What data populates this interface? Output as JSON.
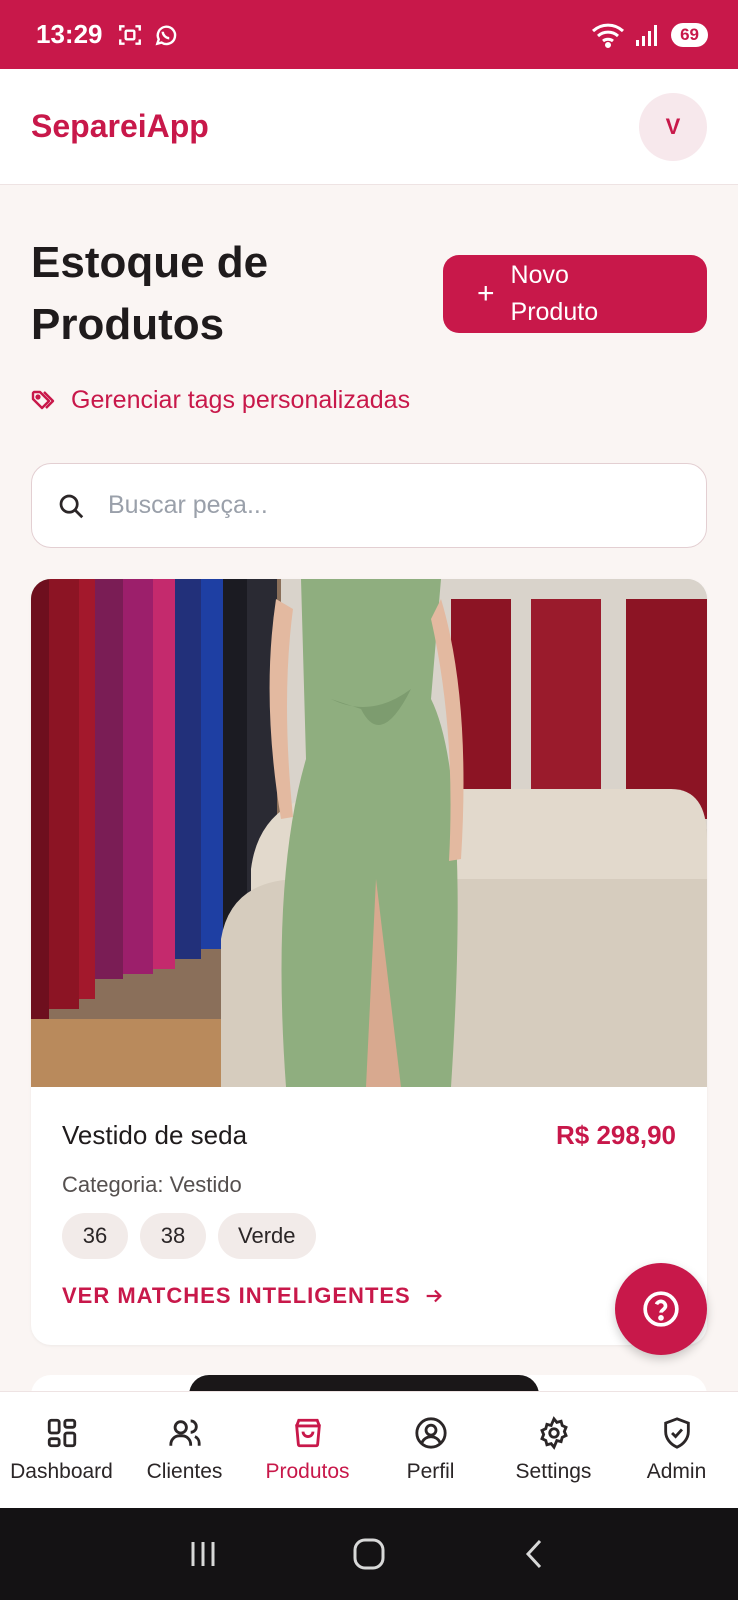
{
  "status_bar": {
    "time": "13:29",
    "battery": "69"
  },
  "header": {
    "app_title": "SepareiApp",
    "avatar_initial": "V"
  },
  "page": {
    "title": "Estoque de Produtos",
    "new_product_button": "Novo Produto",
    "tags_link": "Gerenciar tags personalizadas",
    "search_placeholder": "Buscar peça..."
  },
  "products": [
    {
      "name": "Vestido de seda",
      "price": "R$ 298,90",
      "category": "Categoria: Vestido",
      "chips": [
        "36",
        "38",
        "Verde"
      ],
      "matches_link": "VER MATCHES INTELIGENTES"
    }
  ],
  "bottom_nav": [
    {
      "label": "Dashboard",
      "icon": "grid-icon"
    },
    {
      "label": "Clientes",
      "icon": "users-icon"
    },
    {
      "label": "Produtos",
      "icon": "shopping-bag-icon",
      "active": true
    },
    {
      "label": "Perfil",
      "icon": "user-circle-icon"
    },
    {
      "label": "Settings",
      "icon": "gear-icon"
    },
    {
      "label": "Admin",
      "icon": "shield-check-icon"
    }
  ],
  "colors": {
    "accent": "#c8184a",
    "background": "#faf5f3"
  }
}
